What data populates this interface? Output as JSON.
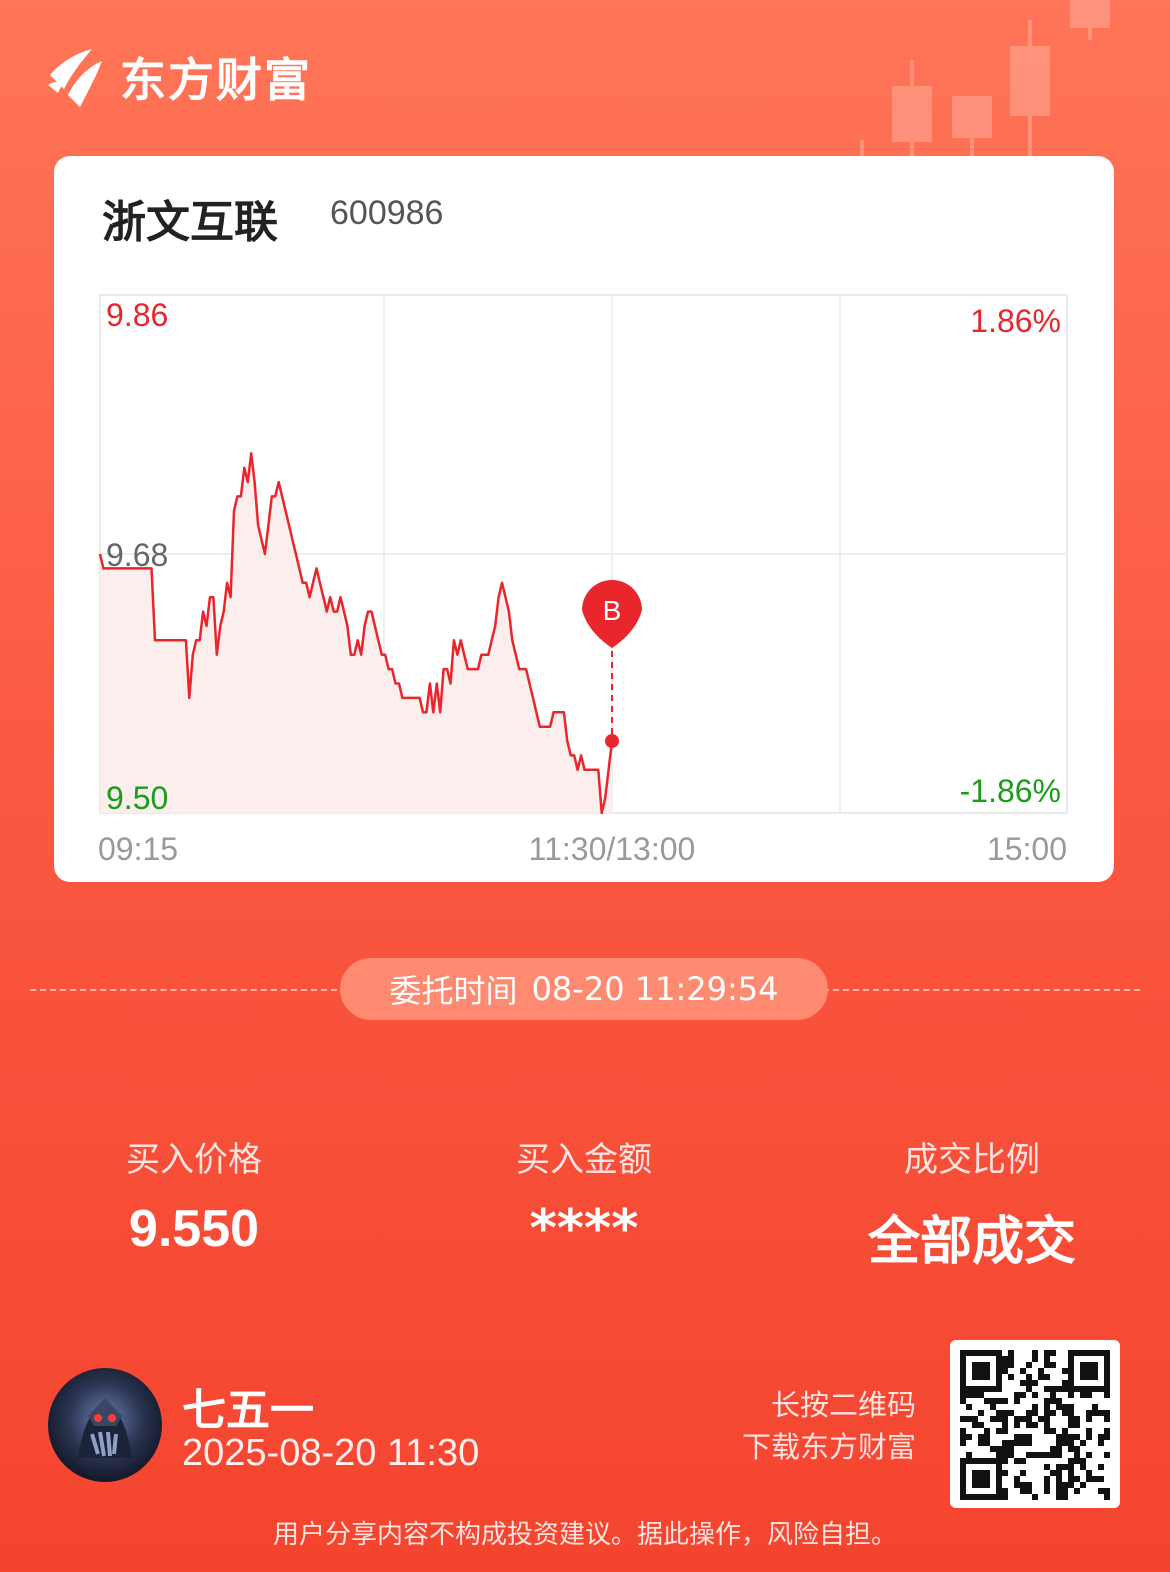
{
  "brand": {
    "name": "东方财富",
    "logo_icon": "eastmoney-logo-icon"
  },
  "stock": {
    "name": "浙文互联",
    "code": "600986"
  },
  "chart_data": {
    "type": "line",
    "y_labels": {
      "top": "9.86",
      "mid": "9.68",
      "bottom": "9.50"
    },
    "pct_labels": {
      "top": "1.86%",
      "bottom": "-1.86%"
    },
    "x_labels": {
      "start": "09:15",
      "mid": "11:30/13:00",
      "end": "15:00"
    },
    "ylim": [
      9.5,
      9.86
    ],
    "marker": {
      "label": "B",
      "price": 9.55
    },
    "colors": {
      "up": "#e8262b",
      "down": "#1a9e1a",
      "line": "#e8262b"
    },
    "values": [
      9.68,
      9.67,
      9.67,
      9.67,
      9.67,
      9.67,
      9.67,
      9.67,
      9.67,
      9.67,
      9.67,
      9.67,
      9.67,
      9.67,
      9.67,
      9.67,
      9.62,
      9.62,
      9.62,
      9.62,
      9.62,
      9.62,
      9.62,
      9.62,
      9.62,
      9.62,
      9.58,
      9.61,
      9.62,
      9.62,
      9.64,
      9.63,
      9.65,
      9.65,
      9.61,
      9.63,
      9.64,
      9.66,
      9.65,
      9.71,
      9.72,
      9.72,
      9.74,
      9.73,
      9.75,
      9.73,
      9.7,
      9.69,
      9.68,
      9.7,
      9.72,
      9.72,
      9.73,
      9.72,
      9.71,
      9.7,
      9.69,
      9.68,
      9.67,
      9.66,
      9.66,
      9.65,
      9.66,
      9.67,
      9.66,
      9.65,
      9.64,
      9.65,
      9.64,
      9.64,
      9.65,
      9.64,
      9.63,
      9.61,
      9.61,
      9.62,
      9.61,
      9.63,
      9.64,
      9.64,
      9.63,
      9.62,
      9.61,
      9.61,
      9.6,
      9.6,
      9.59,
      9.59,
      9.58,
      9.58,
      9.58,
      9.58,
      9.58,
      9.58,
      9.57,
      9.57,
      9.59,
      9.57,
      9.59,
      9.57,
      9.6,
      9.6,
      9.59,
      9.62,
      9.61,
      9.62,
      9.61,
      9.6,
      9.6,
      9.6,
      9.6,
      9.61,
      9.61,
      9.61,
      9.62,
      9.63,
      9.65,
      9.66,
      9.65,
      9.64,
      9.62,
      9.61,
      9.6,
      9.6,
      9.6,
      9.59,
      9.58,
      9.57,
      9.56,
      9.56,
      9.56,
      9.56,
      9.57,
      9.57,
      9.57,
      9.57,
      9.55,
      9.54,
      9.54,
      9.53,
      9.54,
      9.53,
      9.53,
      9.53,
      9.53,
      9.53,
      9.5,
      9.51,
      9.53,
      9.55
    ]
  },
  "order": {
    "label": "委托时间",
    "time": "08-20 11:29:54"
  },
  "stats": [
    {
      "label": "买入价格",
      "value": "9.550"
    },
    {
      "label": "买入金额",
      "value": "****"
    },
    {
      "label": "成交比例",
      "value": "全部成交"
    }
  ],
  "user": {
    "name": "七五一",
    "time": "2025-08-20 11:30",
    "avatar_icon": "avatar-image"
  },
  "qr": {
    "line1": "长按二维码",
    "line2": "下载东方财富",
    "icon": "qr-code-icon"
  },
  "disclaimer": "用户分享内容不构成投资建议。据此操作，风险自担。"
}
